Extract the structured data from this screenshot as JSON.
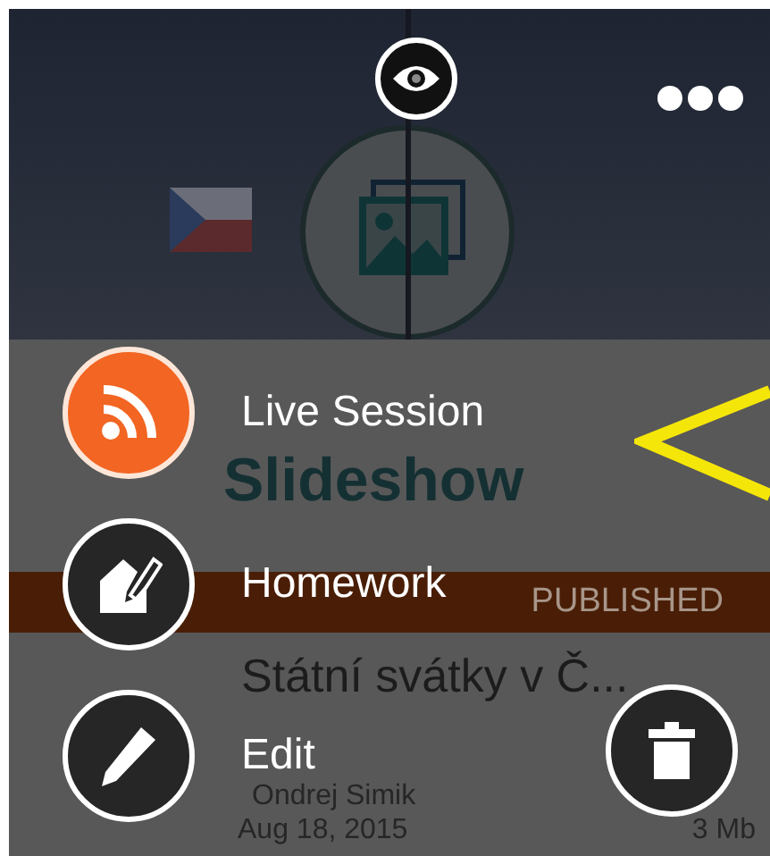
{
  "card": {
    "type": "Slideshow",
    "status": "PUBLISHED",
    "title": "Státní svátky v Č...",
    "author": "Ondrej Simik",
    "date": "Aug 18, 2015",
    "size": "3 Mb"
  },
  "menu": [
    {
      "kind": "live",
      "label": "Live Session"
    },
    {
      "kind": "homework",
      "label": "Homework"
    },
    {
      "kind": "edit",
      "label": "Edit"
    }
  ]
}
